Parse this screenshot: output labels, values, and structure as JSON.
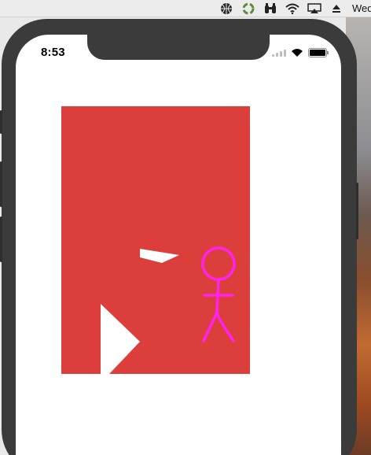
{
  "menubar": {
    "clock_text": "Wed",
    "icons": [
      "basketball-icon",
      "sync-icon",
      "binoculars-icon",
      "wifi-icon",
      "airplay-icon",
      "eject-icon"
    ]
  },
  "status_bar": {
    "time": "8:53",
    "wifi": true,
    "battery_level": 1.0
  },
  "game": {
    "background_color": "#dc3f3b",
    "obstacle_color": "#ffffff",
    "player_color": "#ff22ee",
    "objects": [
      "player-stick-figure",
      "white-flying-shard",
      "white-triangle-obstacle"
    ]
  }
}
